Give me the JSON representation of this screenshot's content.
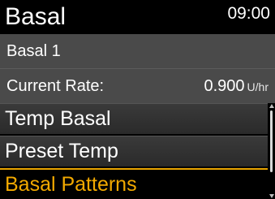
{
  "header": {
    "title": "Basal",
    "time": "09:00"
  },
  "info": {
    "pattern_name": "Basal 1",
    "current_rate_label": "Current Rate:",
    "current_rate_value": "0.900",
    "current_rate_unit": "U/hr"
  },
  "menu": {
    "items": [
      {
        "label": "Temp Basal"
      },
      {
        "label": "Preset Temp"
      },
      {
        "label": "Basal Patterns"
      }
    ],
    "selected_index": 2
  },
  "colors": {
    "accent": "#f2a900",
    "info_background": "#4a4a4a",
    "menu_background": "#333333"
  },
  "icons": {
    "scroll_up": "triangle-up-icon",
    "scroll_down": "triangle-down-icon"
  }
}
